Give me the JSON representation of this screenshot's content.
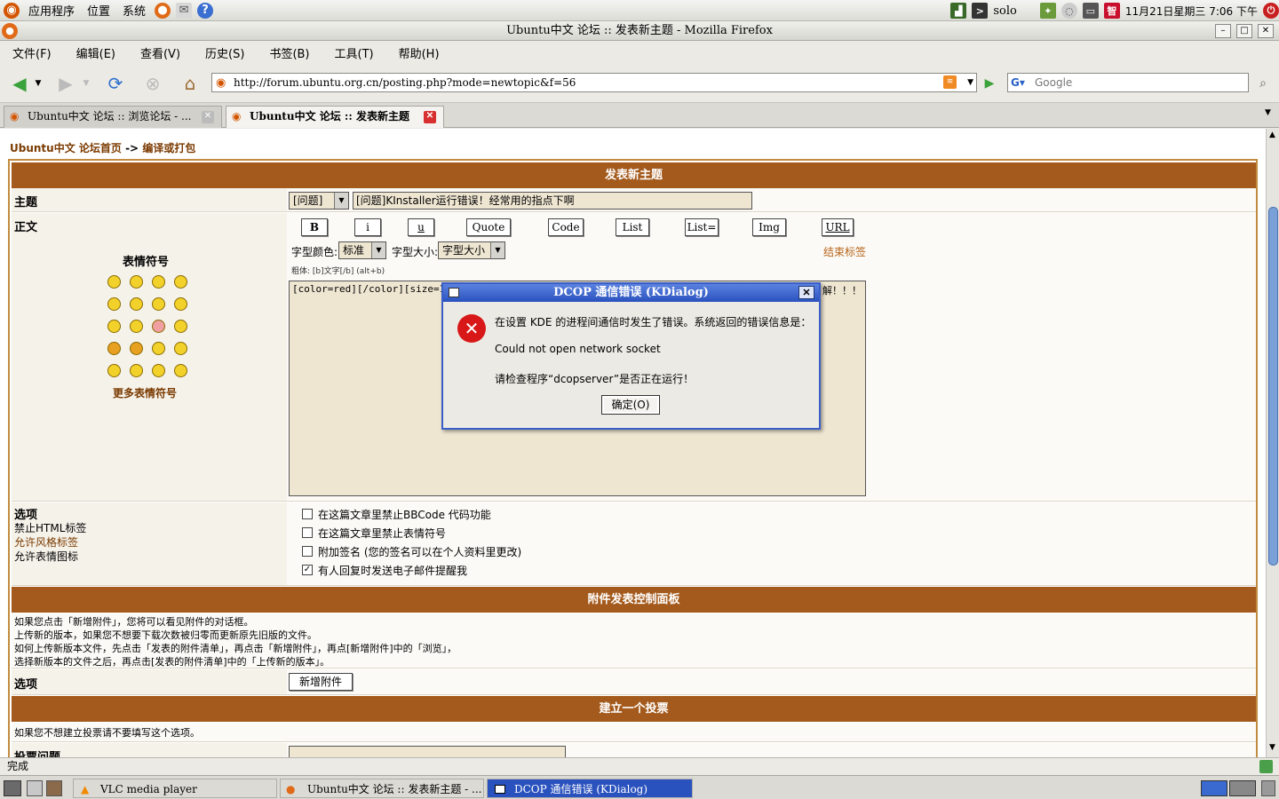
{
  "panel": {
    "menus": [
      "应用程序",
      "位置",
      "系统"
    ],
    "user": "solo",
    "clock": "11月21日星期三  7:06 下午"
  },
  "window": {
    "title": "Ubuntu中文 论坛 :: 发表新主题 - Mozilla Firefox"
  },
  "menubar": [
    "文件(F)",
    "编辑(E)",
    "查看(V)",
    "历史(S)",
    "书签(B)",
    "工具(T)",
    "帮助(H)"
  ],
  "navbar": {
    "url": "http://forum.ubuntu.org.cn/posting.php?mode=newtopic&f=56",
    "search_placeholder": "Google"
  },
  "tabs": [
    {
      "label": "Ubuntu中文 论坛 :: 浏览论坛 - ...",
      "active": false
    },
    {
      "label": "Ubuntu中文 论坛 :: 发表新主题",
      "active": true
    }
  ],
  "page": {
    "breadcrumb_home": "Ubuntu中文 论坛首页",
    "breadcrumb_sep": "->",
    "breadcrumb_forum": "编译或打包",
    "header_post": "发表新主题",
    "subject_label": "主题",
    "subject_prefix": "[问题]",
    "subject_value": "[问题]KInstaller运行错误！经常用的指点下啊",
    "body_label": "正文",
    "emoticons_title": "表情符号",
    "more_emoticons": "更多表情符号",
    "bbcode_buttons": [
      "B",
      "i",
      "u",
      "Quote",
      "Code",
      "List",
      "List=",
      "Img",
      "URL"
    ],
    "font_color_label": "字型颜色:",
    "font_color_value": "标准",
    "font_size_label": "字型大小:",
    "font_size_value": "字型大小",
    "close_tags": "结束标签",
    "hint": "粗体: [b]文字[/b]  (alt+b)",
    "textarea_value": "[color=red][/color][size=10][/s",
    "textarea_tail": "解！！！",
    "options_label": "选项",
    "html_line": "禁止HTML标签",
    "bbcode_line": "允许风格标签",
    "smilies_line": "允许表情图标",
    "checkboxes": [
      {
        "label": "在这篇文章里禁止BBCode 代码功能",
        "checked": false
      },
      {
        "label": "在这篇文章里禁止表情符号",
        "checked": false
      },
      {
        "label": "附加签名 (您的签名可以在个人资料里更改)",
        "checked": false
      },
      {
        "label": "有人回复时发送电子邮件提醒我",
        "checked": true
      }
    ],
    "header_attach": "附件发表控制面板",
    "attach_text": [
      "如果您点击「新增附件」，您将可以看见附件的对话框。",
      "上传新的版本，如果您不想要下载次数被归零而更新原先旧版的文件。",
      "如何上传新版本文件，先点击「发表的附件清单」，再点击「新增附件」，再点[新增附件]中的「浏览」，",
      "选择新版本的文件之后，再点击[发表的附件清单]中的「上传新的版本」。"
    ],
    "options_label2": "选项",
    "add_attach_button": "新增附件",
    "header_poll": "建立一个投票",
    "poll_hint": "如果您不想建立投票请不要填写这个选项。",
    "poll_question_label": "投票问题"
  },
  "dialog": {
    "title": "DCOP 通信错误 (KDialog)",
    "line1": "在设置 KDE 的进程间通信时发生了错误。系统返回的错误信息是：",
    "line2": "Could not open network socket",
    "line3": "请检查程序“dcopserver”是否正在运行！",
    "ok_button": "确定(O)"
  },
  "status": {
    "text": "完成"
  },
  "taskbar": [
    {
      "label": "VLC media player",
      "active": false
    },
    {
      "label": "Ubuntu中文 论坛 :: 发表新主题 - ...",
      "active": false
    },
    {
      "label": "DCOP 通信错误 (KDialog)",
      "active": true
    }
  ],
  "colors": {
    "accent_header": "#a45a1c",
    "link": "#7a3a00",
    "dialog_title": "#2a52be",
    "textarea": "#efe6d2"
  }
}
